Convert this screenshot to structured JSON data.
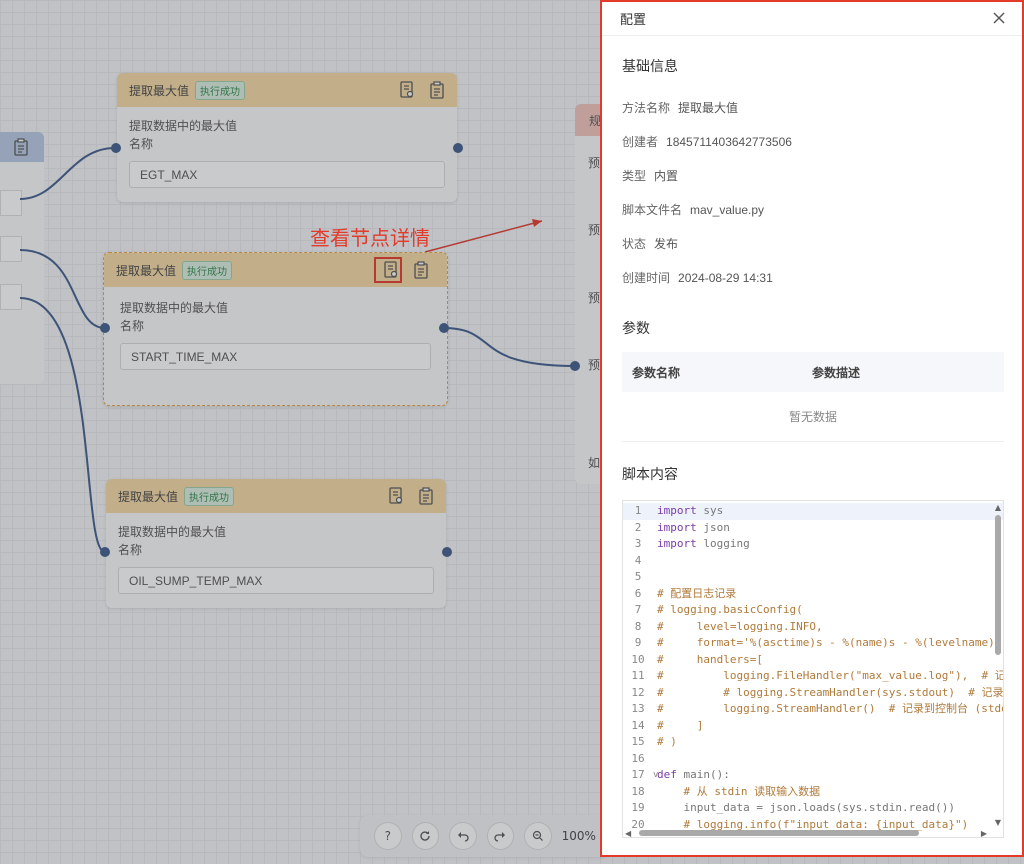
{
  "canvas": {
    "nodes": [
      {
        "title": "提取最大值",
        "badge": "执行成功",
        "desc": "提取数据中的最大值",
        "field_label": "名称",
        "value": "EGT_MAX"
      },
      {
        "title": "提取最大值",
        "badge": "执行成功",
        "desc": "提取数据中的最大值",
        "field_label": "名称",
        "value": "START_TIME_MAX"
      },
      {
        "title": "提取最大值",
        "badge": "执行成功",
        "desc": "提取数据中的最大值",
        "field_label": "名称",
        "value": "OIL_SUMP_TEMP_MAX"
      }
    ],
    "annotation": "查看节点详情",
    "right_stub_chars": [
      "规",
      "预",
      "预",
      "预",
      "预",
      "如"
    ],
    "zoom": {
      "help": "?",
      "zoom_text": "100%"
    }
  },
  "panel": {
    "title": "配置",
    "basic_title": "基础信息",
    "info": [
      {
        "k": "方法名称",
        "v": "提取最大值"
      },
      {
        "k": "创建者",
        "v": "1845711403642773506"
      },
      {
        "k": "类型",
        "v": "内置"
      },
      {
        "k": "脚本文件名",
        "v": "mav_value.py"
      },
      {
        "k": "状态",
        "v": "发布"
      },
      {
        "k": "创建时间",
        "v": "2024-08-29 14:31"
      }
    ],
    "params_title": "参数",
    "param_headers": [
      "参数名称",
      "参数描述"
    ],
    "param_empty": "暂无数据",
    "script_title": "脚本内容",
    "code": [
      "import sys",
      "import json",
      "import logging",
      "",
      "",
      "# 配置日志记录",
      "# logging.basicConfig(",
      "#     level=logging.INFO,",
      "#     format='%(asctime)s - %(name)s - %(levelname)s - %",
      "#     handlers=[",
      "#         logging.FileHandler(\"max_value.log\"),  # 记录到",
      "#         # logging.StreamHandler(sys.stdout)  # 记录到",
      "#         logging.StreamHandler()  # 记录到控制台 (stdou",
      "#     ]",
      "# )",
      "",
      "def main():",
      "    # 从 stdin 读取输入数据",
      "    input_data = json.loads(sys.stdin.read())",
      "    # logging.info(f\"input_data: {input_data}\")"
    ]
  }
}
